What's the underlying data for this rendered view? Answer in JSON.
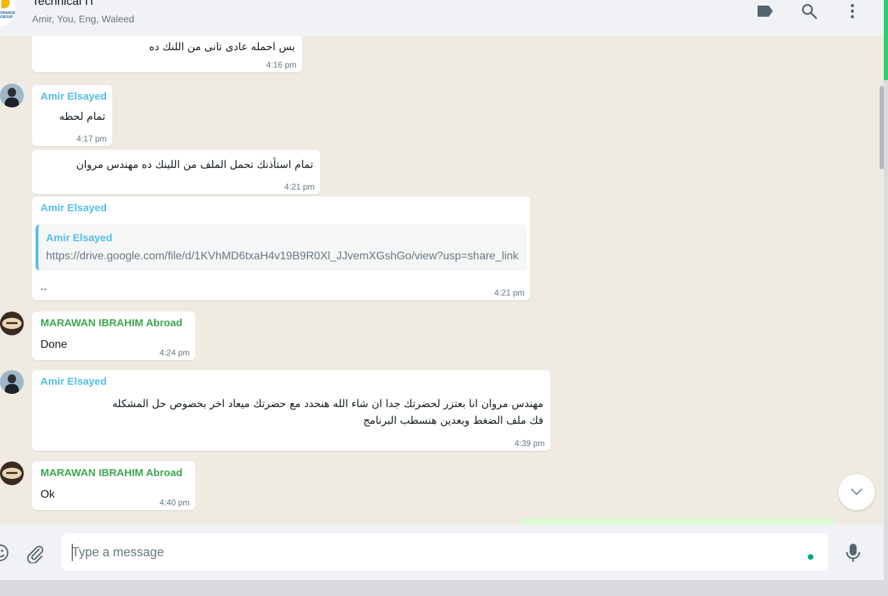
{
  "header": {
    "title": "Technical IT",
    "members": "Amir, You, Eng, Waleed",
    "logo_text": "ORANGE GROUP",
    "icons": [
      "label-icon",
      "search-icon",
      "menu-icon"
    ]
  },
  "messages": [
    {
      "text": "بس احمله عادى تانى من اللنك ده",
      "time": "4:16 pm"
    },
    {
      "sender": "Amir Elsayed",
      "text": "تمام لحظه",
      "time": "4:17 pm"
    },
    {
      "text": "تمام استأذنك تحمل الملف من اللينك ده مهندس مروان",
      "time": "4:21 pm"
    },
    {
      "sender": "Amir Elsayed",
      "quote_sender": "Amir Elsayed",
      "quote_text": "https://drive.google.com/file/d/1KVhMD6txaH4v19B9R0Xl_JJvemXGshGo/view?usp=share_link",
      "text": "..",
      "time": "4:21 pm"
    },
    {
      "sender": "MARAWAN IBRAHIM Abroad",
      "text": "Done",
      "time": "4:24 pm"
    },
    {
      "sender": "Amir Elsayed",
      "text_line1": "مهندس مروان انا بعتزر لحضرتك جدا ان شاء الله هنحدد مع حضرتك ميعاد اخر بخصوص حل المشكله",
      "text_line2": "فك ملف الضغط وبعدين هنسطب البرنامج",
      "time": "4:39 pm"
    },
    {
      "sender": "MARAWAN IBRAHIM Abroad",
      "text": "Ok",
      "time": "4:40 pm"
    }
  ],
  "composer": {
    "placeholder": "Type a message",
    "value": ""
  },
  "colors": {
    "chat_bg": "#efeae2",
    "panel_bg": "#f0f2f5",
    "amir_name": "#53bdeb",
    "marawan_name": "#3ea650",
    "accent": "#25d366"
  }
}
